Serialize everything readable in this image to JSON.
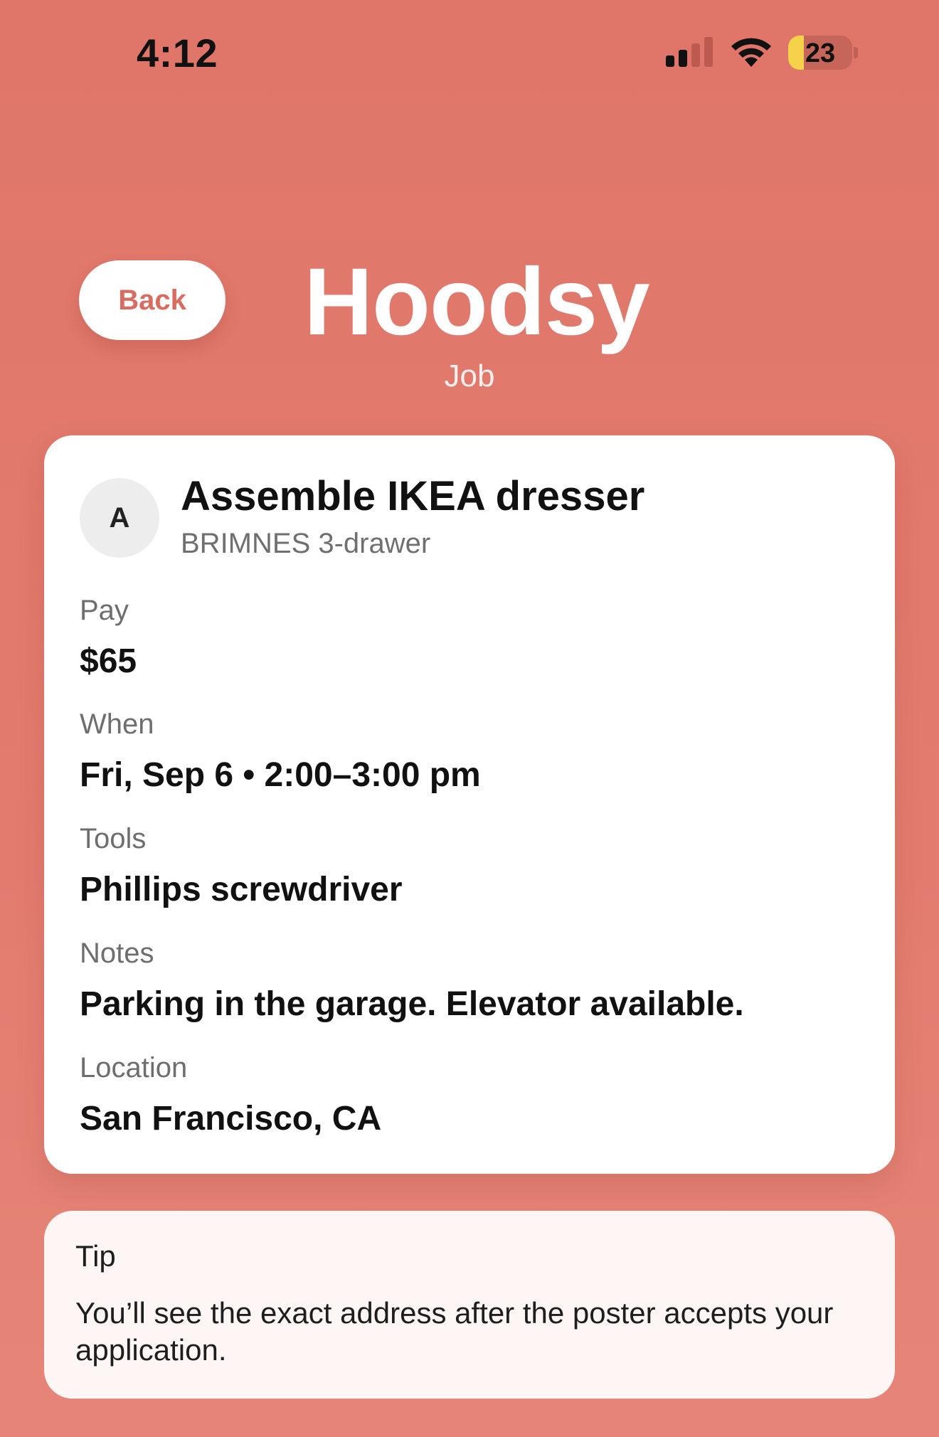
{
  "status_bar": {
    "time": "4:12",
    "battery_level": "23",
    "icons": [
      "signal-icon",
      "wifi-icon",
      "battery-icon"
    ]
  },
  "header": {
    "back_label": "Back",
    "app_title": "Hoodsy",
    "page_subtitle": "Job"
  },
  "job": {
    "avatar_initial": "A",
    "title": "Assemble IKEA dresser",
    "subtitle": "BRIMNES 3-drawer",
    "fields": [
      {
        "label": "Pay",
        "value": "$65"
      },
      {
        "label": "When",
        "value": "Fri, Sep 6 • 2:00–3:00 pm"
      },
      {
        "label": "Tools",
        "value": "Phillips screwdriver"
      },
      {
        "label": "Notes",
        "value": "Parking in the garage. Elevator available."
      },
      {
        "label": "Location",
        "value": "San Francisco, CA"
      }
    ]
  },
  "tip": {
    "title": "Tip",
    "text": "You’ll see the exact address after the poster accepts your application."
  },
  "colors": {
    "background": "#E0766A",
    "accent": "#D86C60",
    "card": "#FFFFFF",
    "tip_card": "#FDF6F4",
    "battery_fill": "#F6D24A"
  }
}
